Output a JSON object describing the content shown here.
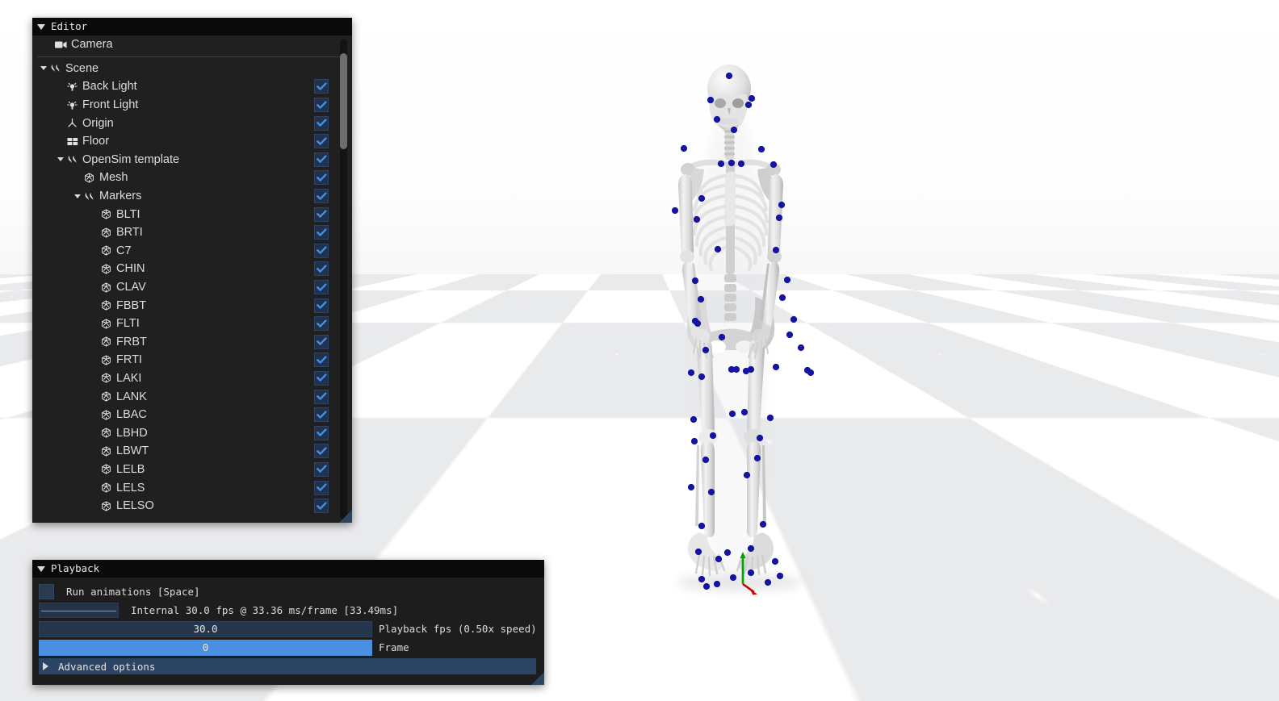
{
  "viewport": {
    "name": "3d-viewport",
    "background": "#ffffff",
    "floor_color_a": "#ffffff",
    "floor_color_b": "#e9eaec",
    "marker_color": "#1414a0",
    "bone_color": "#e6e6e6",
    "axis_x_color": "#cc0000",
    "axis_y_color": "#00aa00"
  },
  "editor": {
    "title": "Editor",
    "collapse_icon": "triangle-down-icon",
    "camera": {
      "label": "Camera",
      "icon": "camera-icon"
    },
    "tree": [
      {
        "label": "Scene",
        "icon": "scene-icon",
        "depth": 0,
        "arrow": "down",
        "checkbox": null
      },
      {
        "label": "Back Light",
        "icon": "light-icon",
        "depth": 1,
        "arrow": null,
        "checkbox": true
      },
      {
        "label": "Front Light",
        "icon": "light-icon",
        "depth": 1,
        "arrow": null,
        "checkbox": true
      },
      {
        "label": "Origin",
        "icon": "origin-icon",
        "depth": 1,
        "arrow": null,
        "checkbox": true
      },
      {
        "label": "Floor",
        "icon": "floor-icon",
        "depth": 1,
        "arrow": null,
        "checkbox": true
      },
      {
        "label": "OpenSim template",
        "icon": "scene-icon",
        "depth": 1,
        "arrow": "down",
        "checkbox": true
      },
      {
        "label": "Mesh",
        "icon": "mesh-icon",
        "depth": 2,
        "arrow": null,
        "checkbox": true
      },
      {
        "label": "Markers",
        "icon": "scene-icon",
        "depth": 2,
        "arrow": "down",
        "checkbox": true
      },
      {
        "label": "BLTI",
        "icon": "mesh-icon",
        "depth": 3,
        "arrow": null,
        "checkbox": true
      },
      {
        "label": "BRTI",
        "icon": "mesh-icon",
        "depth": 3,
        "arrow": null,
        "checkbox": true
      },
      {
        "label": "C7",
        "icon": "mesh-icon",
        "depth": 3,
        "arrow": null,
        "checkbox": true
      },
      {
        "label": "CHIN",
        "icon": "mesh-icon",
        "depth": 3,
        "arrow": null,
        "checkbox": true
      },
      {
        "label": "CLAV",
        "icon": "mesh-icon",
        "depth": 3,
        "arrow": null,
        "checkbox": true
      },
      {
        "label": "FBBT",
        "icon": "mesh-icon",
        "depth": 3,
        "arrow": null,
        "checkbox": true
      },
      {
        "label": "FLTI",
        "icon": "mesh-icon",
        "depth": 3,
        "arrow": null,
        "checkbox": true
      },
      {
        "label": "FRBT",
        "icon": "mesh-icon",
        "depth": 3,
        "arrow": null,
        "checkbox": true
      },
      {
        "label": "FRTI",
        "icon": "mesh-icon",
        "depth": 3,
        "arrow": null,
        "checkbox": true
      },
      {
        "label": "LAKI",
        "icon": "mesh-icon",
        "depth": 3,
        "arrow": null,
        "checkbox": true
      },
      {
        "label": "LANK",
        "icon": "mesh-icon",
        "depth": 3,
        "arrow": null,
        "checkbox": true
      },
      {
        "label": "LBAC",
        "icon": "mesh-icon",
        "depth": 3,
        "arrow": null,
        "checkbox": true
      },
      {
        "label": "LBHD",
        "icon": "mesh-icon",
        "depth": 3,
        "arrow": null,
        "checkbox": true
      },
      {
        "label": "LBWT",
        "icon": "mesh-icon",
        "depth": 3,
        "arrow": null,
        "checkbox": true
      },
      {
        "label": "LELB",
        "icon": "mesh-icon",
        "depth": 3,
        "arrow": null,
        "checkbox": true
      },
      {
        "label": "LELS",
        "icon": "mesh-icon",
        "depth": 3,
        "arrow": null,
        "checkbox": true
      },
      {
        "label": "LELSO",
        "icon": "mesh-icon",
        "depth": 3,
        "arrow": null,
        "checkbox": true
      }
    ],
    "scrollbar": {
      "name": "editor-scrollbar",
      "thumb_top_pct": 3,
      "thumb_height_pct": 20
    }
  },
  "playback": {
    "title": "Playback",
    "collapse_icon": "triangle-down-icon",
    "run_animations": {
      "label": "Run animations [Space]",
      "checked": false
    },
    "frame_time_plot": {
      "label": "Internal 30.0 fps @ 33.36 ms/frame [33.49ms]"
    },
    "playback_fps": {
      "value": "30.0",
      "label": "Playback fps  (0.50x speed)",
      "fill_pct": 0
    },
    "frame": {
      "value": "0",
      "label": "Frame",
      "fill_pct": 100
    },
    "advanced_options": {
      "label": "Advanced options",
      "expand_icon": "triangle-right-icon"
    }
  }
}
